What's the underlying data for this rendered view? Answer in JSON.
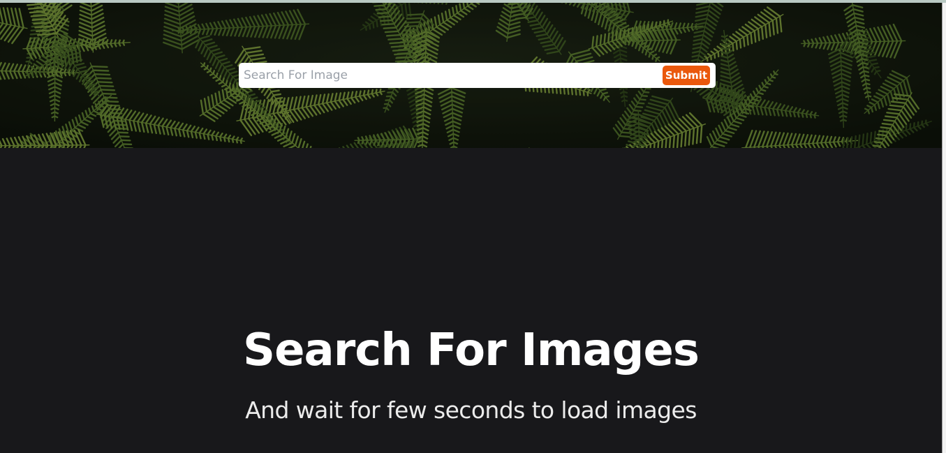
{
  "search": {
    "placeholder": "Search For Image",
    "value": "",
    "submit_label": "Submit"
  },
  "hero": {
    "image": "fern-leaves-background"
  },
  "content": {
    "heading": "Search For Images",
    "subheading": "And wait for few seconds to load images"
  },
  "colors": {
    "page_background": "#18181b",
    "submit_button": "#ea580c",
    "heading_text": "#ffffff"
  }
}
